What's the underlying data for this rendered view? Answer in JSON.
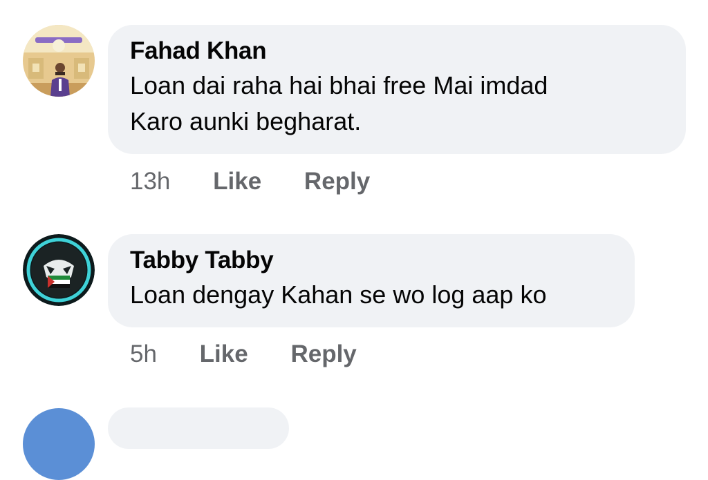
{
  "comments": [
    {
      "author": "Fahad Khan",
      "text_lines": [
        "Loan dai raha hai bhai free Mai imdad",
        "Karo aunki begharat."
      ],
      "time": "13h",
      "like_label": "Like",
      "reply_label": "Reply"
    },
    {
      "author": "Tabby Tabby",
      "text_lines": [
        "Loan dengay Kahan se wo log aap ko"
      ],
      "time": "5h",
      "like_label": "Like",
      "reply_label": "Reply"
    }
  ],
  "colors": {
    "bubble": "#f0f2f5",
    "text": "#050505",
    "secondary": "#65676b"
  }
}
